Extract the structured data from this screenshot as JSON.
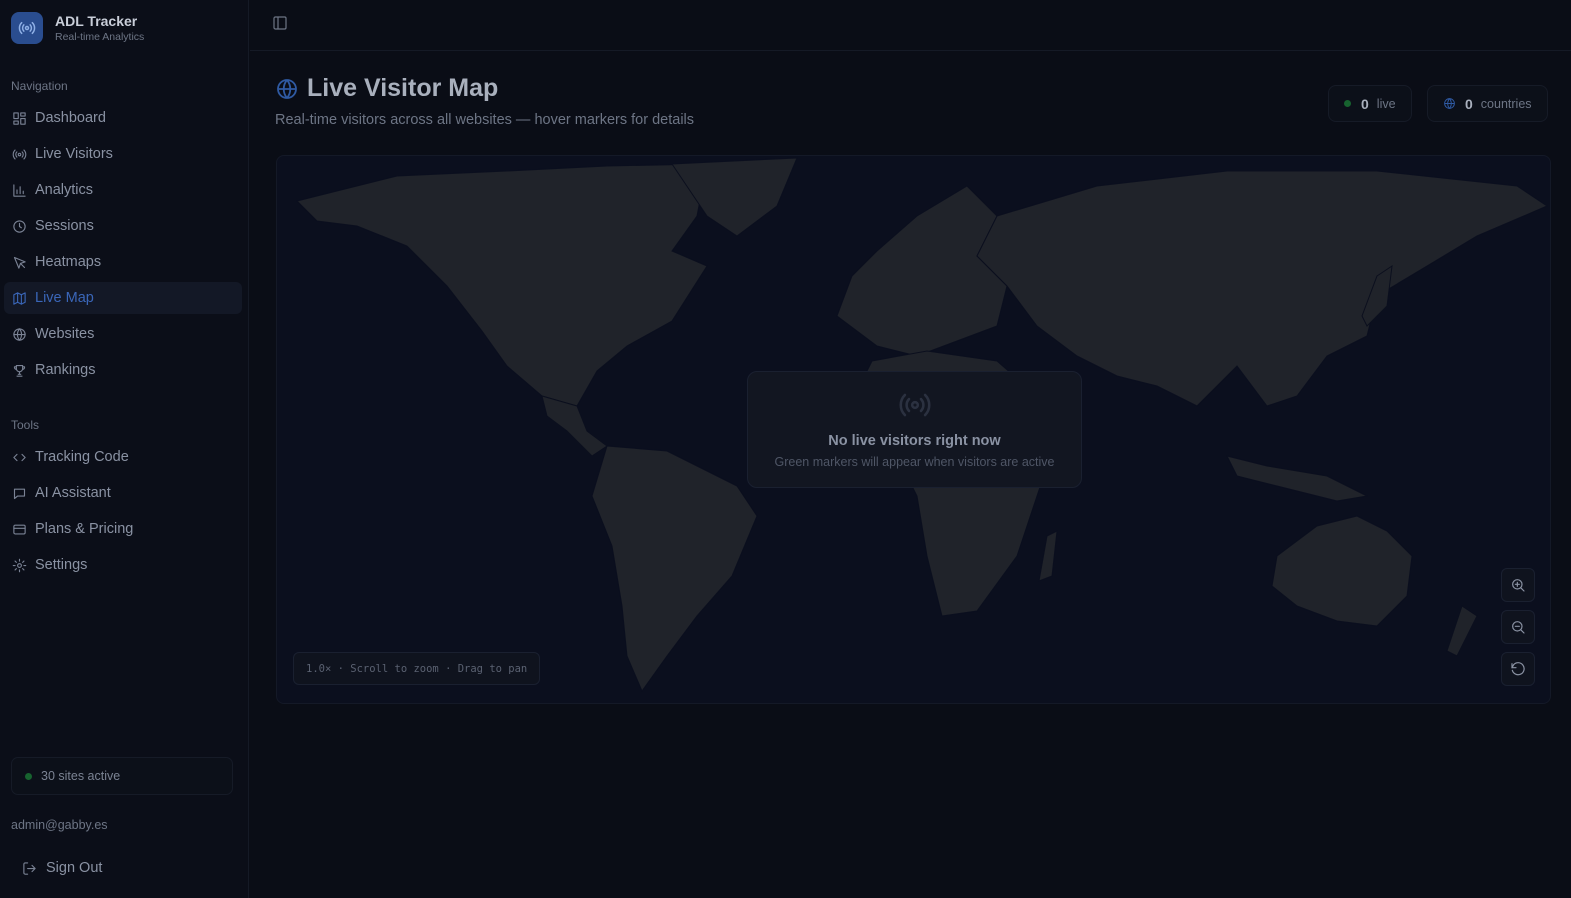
{
  "brand": {
    "title": "ADL Tracker",
    "subtitle": "Real-time Analytics"
  },
  "sidebar": {
    "nav_label": "Navigation",
    "nav_items": [
      {
        "label": "Dashboard",
        "icon": "grid-icon"
      },
      {
        "label": "Live Visitors",
        "icon": "radio-icon"
      },
      {
        "label": "Analytics",
        "icon": "bar-chart-icon"
      },
      {
        "label": "Sessions",
        "icon": "clock-icon"
      },
      {
        "label": "Heatmaps",
        "icon": "cursor-icon"
      },
      {
        "label": "Live Map",
        "icon": "map-icon",
        "active": true
      },
      {
        "label": "Websites",
        "icon": "globe-icon"
      },
      {
        "label": "Rankings",
        "icon": "trophy-icon"
      }
    ],
    "tools_label": "Tools",
    "tool_items": [
      {
        "label": "Tracking Code",
        "icon": "code-icon"
      },
      {
        "label": "AI Assistant",
        "icon": "chat-icon"
      },
      {
        "label": "Plans & Pricing",
        "icon": "credit-card-icon"
      },
      {
        "label": "Settings",
        "icon": "gear-icon"
      }
    ],
    "sites_status": "30 sites active",
    "email": "admin@gabby.es",
    "sign_out": "Sign Out"
  },
  "page": {
    "title": "Live Visitor Map",
    "subtitle": "Real-time visitors across all websites — hover markers for details"
  },
  "stats": {
    "live_count": "0",
    "live_label": "live",
    "countries_count": "0",
    "countries_label": "countries"
  },
  "map": {
    "empty_title": "No live visitors right now",
    "empty_subtitle": "Green markers will appear when visitors are active",
    "zoom_hint": "1.0× · Scroll to zoom · Drag to pan"
  },
  "colors": {
    "accent": "#2f5aa3",
    "live_dot": "#17632f",
    "background": "#0a0d16"
  }
}
